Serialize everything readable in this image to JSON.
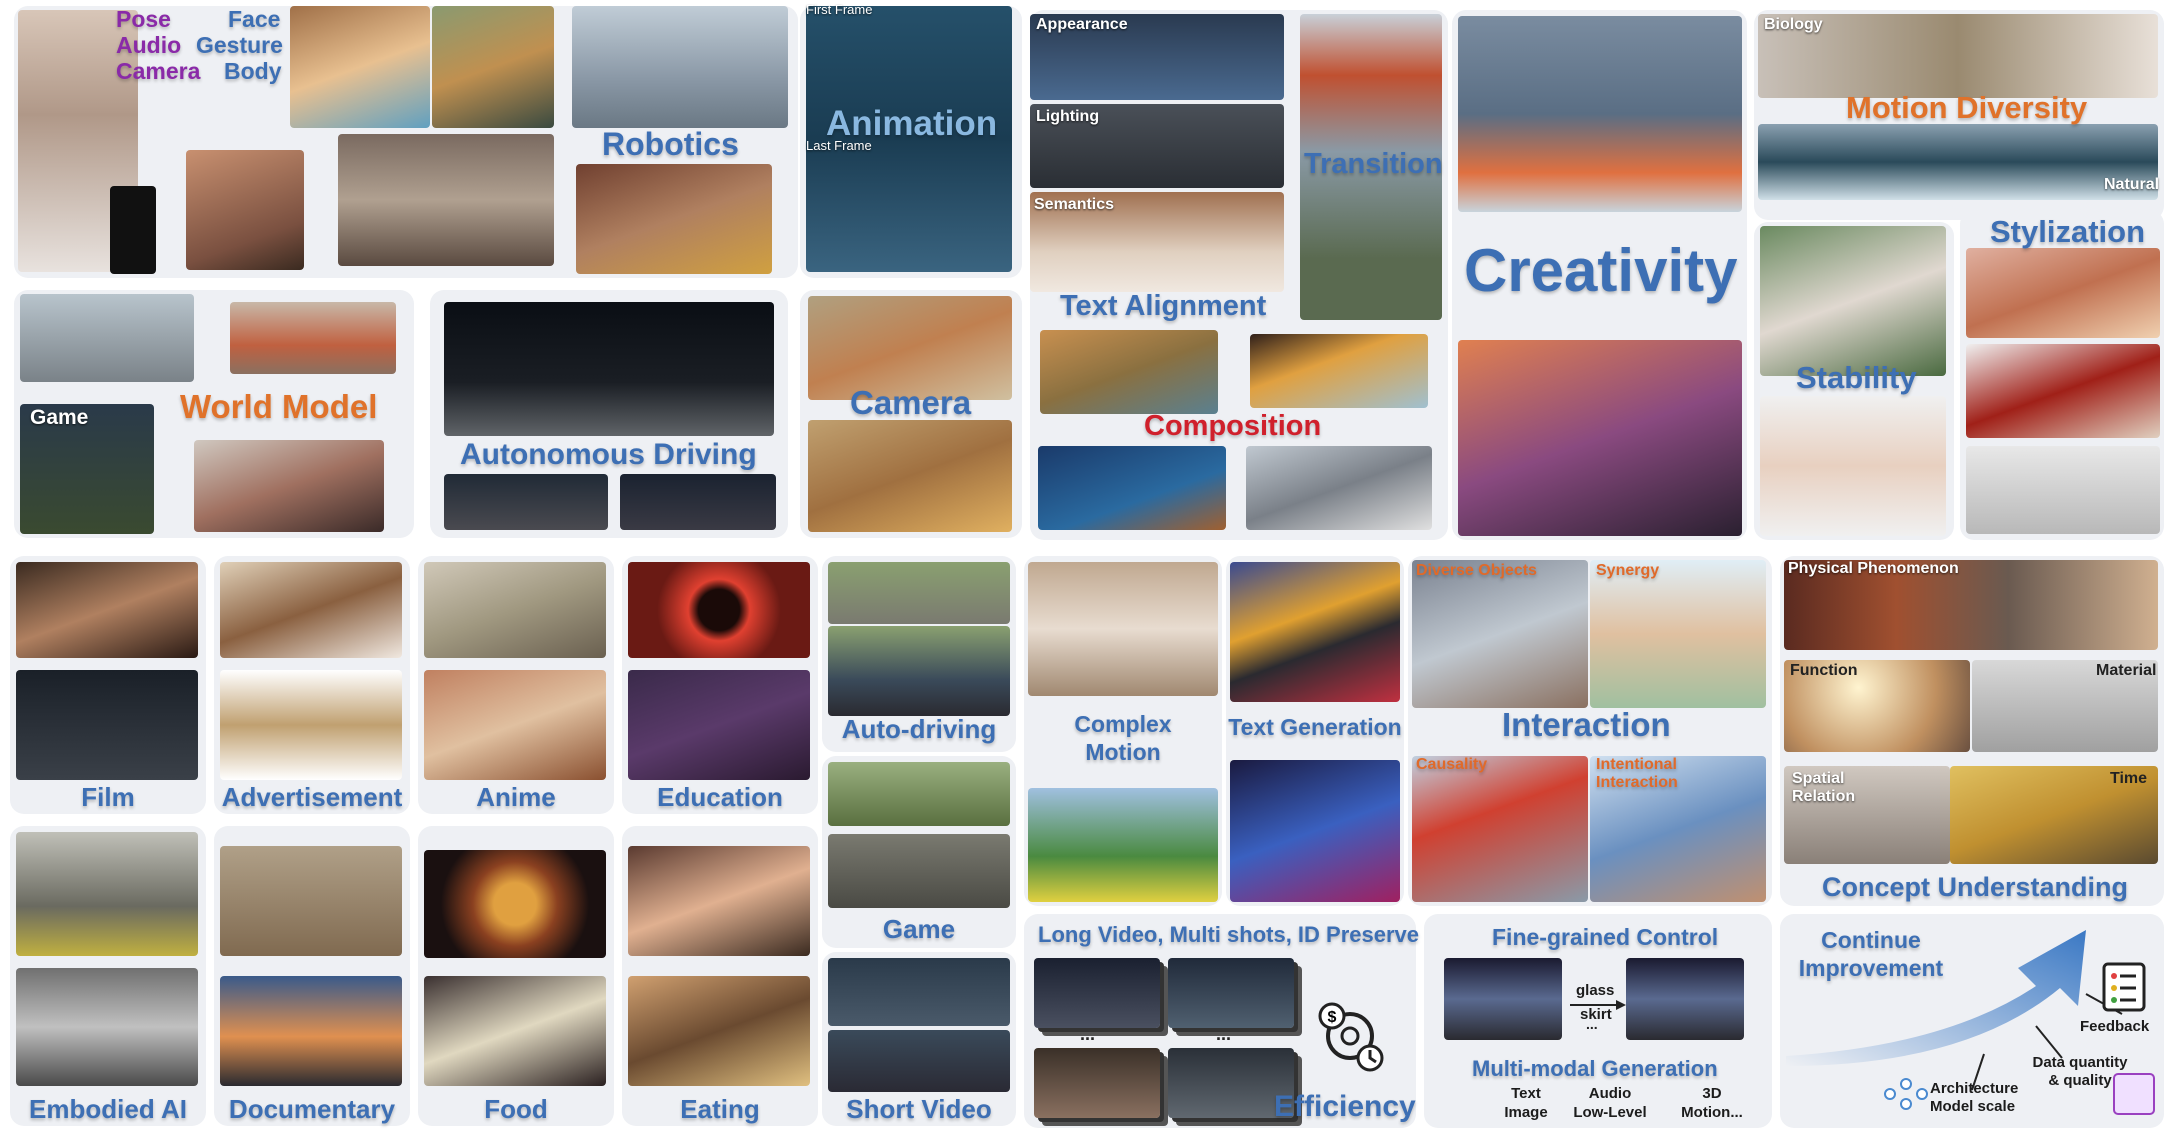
{
  "colors": {
    "panel": "#eef0f4",
    "blue_label": "#3d6fb4",
    "orange_label": "#e0722a",
    "red_label": "#d0202c",
    "purple_label": "#8a2aa8"
  },
  "tl": {
    "pose": "Pose",
    "audio": "Audio",
    "camera": "Camera",
    "face": "Face",
    "gesture": "Gesture",
    "body": "Body",
    "robotics": "Robotics",
    "first_frame": "First Frame",
    "last_frame": "Last Frame",
    "animation": "Animation",
    "game": "Game",
    "world_model": "World Model",
    "autonomous_driving": "Autonomous Driving",
    "camera_label": "Camera"
  },
  "tc": {
    "appearance": "Appearance",
    "lighting": "Lighting",
    "semantics": "Semantics",
    "transition": "Transition",
    "text_alignment": "Text Alignment",
    "composition": "Composition",
    "creativity": "Creativity"
  },
  "tr": {
    "biology": "Biology",
    "natural": "Natural",
    "motion_diversity": "Motion Diversity",
    "stylization": "Stylization",
    "stability": "Stability"
  },
  "bl": {
    "film": "Film",
    "advertisement": "Advertisement",
    "anime": "Anime",
    "education": "Education",
    "auto_driving": "Auto-driving",
    "game": "Game",
    "embodied_ai": "Embodied AI",
    "documentary": "Documentary",
    "food": "Food",
    "eating": "Eating",
    "short_video": "Short Video"
  },
  "bm": {
    "complex_motion": "Complex\nMotion",
    "text_generation": "Text Generation",
    "diverse_objects": "Diverse Objects",
    "synergy": "Synergy",
    "interaction": "Interaction",
    "causality": "Causality",
    "intentional_interaction": "Intentional\nInteraction",
    "long_video": "Long Video, Multi shots, ID Preserve",
    "ellipsis": "...",
    "efficiency": "Efficiency",
    "fine_grained": "Fine-grained Control",
    "glass": "glass",
    "skirt": "skirt",
    "multimodal": "Multi-modal Generation",
    "text_image": "Text\nImage",
    "audio_low": "Audio\nLow-Level",
    "motion3d": "3D\nMotion..."
  },
  "br": {
    "physical": "Physical Phenomenon",
    "function": "Function",
    "material": "Material",
    "spatial": "Spatial\nRelation",
    "time": "Time",
    "concept": "Concept Understanding",
    "continue": "Continue\nImprovement",
    "feedback": "Feedback",
    "data_quality": "Data quantity\n& quality",
    "architecture": "Architecture\nModel scale"
  }
}
